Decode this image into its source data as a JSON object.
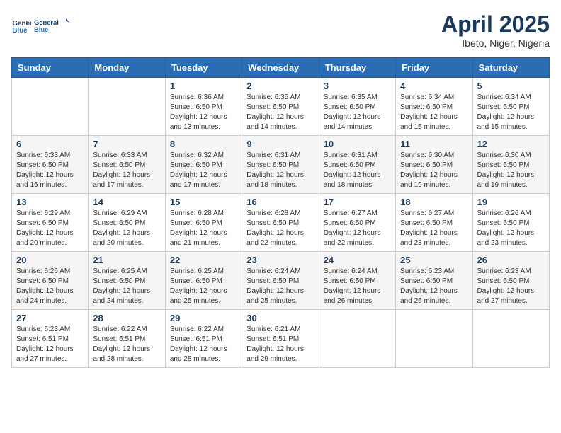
{
  "header": {
    "logo_line1": "General",
    "logo_line2": "Blue",
    "month_year": "April 2025",
    "location": "Ibeto, Niger, Nigeria"
  },
  "weekdays": [
    "Sunday",
    "Monday",
    "Tuesday",
    "Wednesday",
    "Thursday",
    "Friday",
    "Saturday"
  ],
  "weeks": [
    [
      {
        "day": "",
        "info": ""
      },
      {
        "day": "",
        "info": ""
      },
      {
        "day": "1",
        "info": "Sunrise: 6:36 AM\nSunset: 6:50 PM\nDaylight: 12 hours\nand 13 minutes."
      },
      {
        "day": "2",
        "info": "Sunrise: 6:35 AM\nSunset: 6:50 PM\nDaylight: 12 hours\nand 14 minutes."
      },
      {
        "day": "3",
        "info": "Sunrise: 6:35 AM\nSunset: 6:50 PM\nDaylight: 12 hours\nand 14 minutes."
      },
      {
        "day": "4",
        "info": "Sunrise: 6:34 AM\nSunset: 6:50 PM\nDaylight: 12 hours\nand 15 minutes."
      },
      {
        "day": "5",
        "info": "Sunrise: 6:34 AM\nSunset: 6:50 PM\nDaylight: 12 hours\nand 15 minutes."
      }
    ],
    [
      {
        "day": "6",
        "info": "Sunrise: 6:33 AM\nSunset: 6:50 PM\nDaylight: 12 hours\nand 16 minutes."
      },
      {
        "day": "7",
        "info": "Sunrise: 6:33 AM\nSunset: 6:50 PM\nDaylight: 12 hours\nand 17 minutes."
      },
      {
        "day": "8",
        "info": "Sunrise: 6:32 AM\nSunset: 6:50 PM\nDaylight: 12 hours\nand 17 minutes."
      },
      {
        "day": "9",
        "info": "Sunrise: 6:31 AM\nSunset: 6:50 PM\nDaylight: 12 hours\nand 18 minutes."
      },
      {
        "day": "10",
        "info": "Sunrise: 6:31 AM\nSunset: 6:50 PM\nDaylight: 12 hours\nand 18 minutes."
      },
      {
        "day": "11",
        "info": "Sunrise: 6:30 AM\nSunset: 6:50 PM\nDaylight: 12 hours\nand 19 minutes."
      },
      {
        "day": "12",
        "info": "Sunrise: 6:30 AM\nSunset: 6:50 PM\nDaylight: 12 hours\nand 19 minutes."
      }
    ],
    [
      {
        "day": "13",
        "info": "Sunrise: 6:29 AM\nSunset: 6:50 PM\nDaylight: 12 hours\nand 20 minutes."
      },
      {
        "day": "14",
        "info": "Sunrise: 6:29 AM\nSunset: 6:50 PM\nDaylight: 12 hours\nand 20 minutes."
      },
      {
        "day": "15",
        "info": "Sunrise: 6:28 AM\nSunset: 6:50 PM\nDaylight: 12 hours\nand 21 minutes."
      },
      {
        "day": "16",
        "info": "Sunrise: 6:28 AM\nSunset: 6:50 PM\nDaylight: 12 hours\nand 22 minutes."
      },
      {
        "day": "17",
        "info": "Sunrise: 6:27 AM\nSunset: 6:50 PM\nDaylight: 12 hours\nand 22 minutes."
      },
      {
        "day": "18",
        "info": "Sunrise: 6:27 AM\nSunset: 6:50 PM\nDaylight: 12 hours\nand 23 minutes."
      },
      {
        "day": "19",
        "info": "Sunrise: 6:26 AM\nSunset: 6:50 PM\nDaylight: 12 hours\nand 23 minutes."
      }
    ],
    [
      {
        "day": "20",
        "info": "Sunrise: 6:26 AM\nSunset: 6:50 PM\nDaylight: 12 hours\nand 24 minutes."
      },
      {
        "day": "21",
        "info": "Sunrise: 6:25 AM\nSunset: 6:50 PM\nDaylight: 12 hours\nand 24 minutes."
      },
      {
        "day": "22",
        "info": "Sunrise: 6:25 AM\nSunset: 6:50 PM\nDaylight: 12 hours\nand 25 minutes."
      },
      {
        "day": "23",
        "info": "Sunrise: 6:24 AM\nSunset: 6:50 PM\nDaylight: 12 hours\nand 25 minutes."
      },
      {
        "day": "24",
        "info": "Sunrise: 6:24 AM\nSunset: 6:50 PM\nDaylight: 12 hours\nand 26 minutes."
      },
      {
        "day": "25",
        "info": "Sunrise: 6:23 AM\nSunset: 6:50 PM\nDaylight: 12 hours\nand 26 minutes."
      },
      {
        "day": "26",
        "info": "Sunrise: 6:23 AM\nSunset: 6:50 PM\nDaylight: 12 hours\nand 27 minutes."
      }
    ],
    [
      {
        "day": "27",
        "info": "Sunrise: 6:23 AM\nSunset: 6:51 PM\nDaylight: 12 hours\nand 27 minutes."
      },
      {
        "day": "28",
        "info": "Sunrise: 6:22 AM\nSunset: 6:51 PM\nDaylight: 12 hours\nand 28 minutes."
      },
      {
        "day": "29",
        "info": "Sunrise: 6:22 AM\nSunset: 6:51 PM\nDaylight: 12 hours\nand 28 minutes."
      },
      {
        "day": "30",
        "info": "Sunrise: 6:21 AM\nSunset: 6:51 PM\nDaylight: 12 hours\nand 29 minutes."
      },
      {
        "day": "",
        "info": ""
      },
      {
        "day": "",
        "info": ""
      },
      {
        "day": "",
        "info": ""
      }
    ]
  ]
}
